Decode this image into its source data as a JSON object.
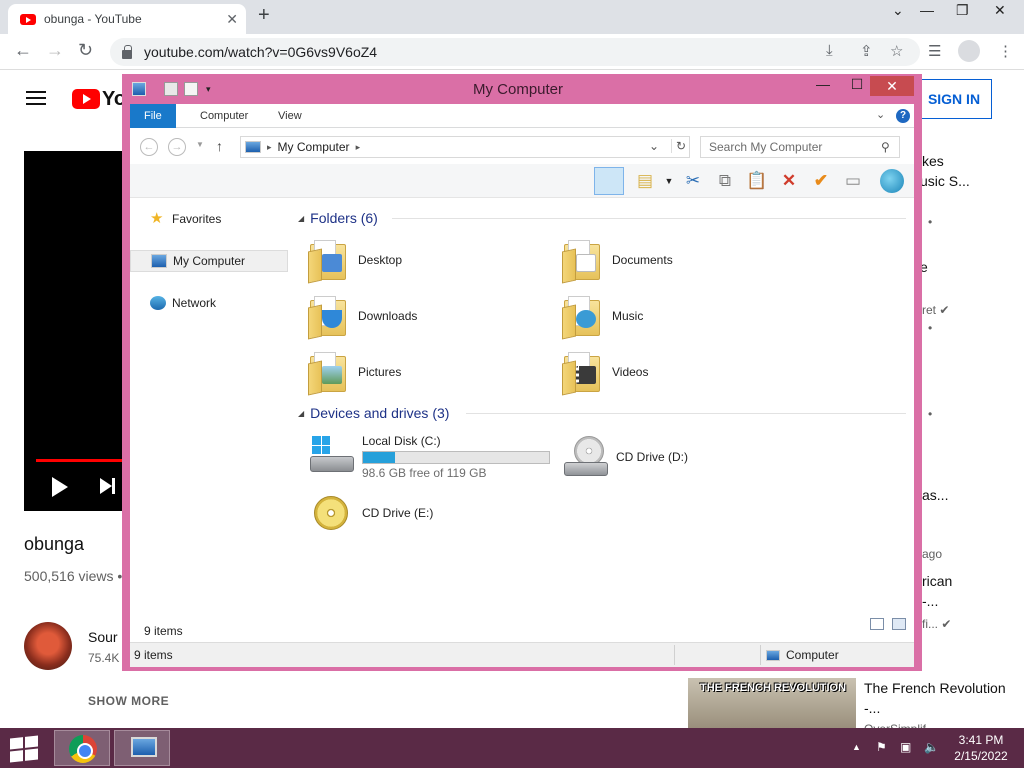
{
  "browser": {
    "tab_title": "obunga - YouTube",
    "tab_close": "✕",
    "new_tab": "+",
    "url": "youtube.com/watch?v=0G6vs9V6oZ4",
    "controls": {
      "collapse": "⌄",
      "minimize": "—",
      "restore": "❐",
      "close": "✕"
    },
    "nav": {
      "back": "←",
      "forward": "→",
      "reload": "↻"
    },
    "toolbar": {
      "download": "⤓",
      "share": "⇪",
      "bookmark": "☆",
      "media": "☰",
      "menu": "⋮"
    }
  },
  "youtube": {
    "logo_text": "Yo",
    "sign_in": "SIGN IN",
    "video_title": "obunga",
    "views": "500,516 views •",
    "channel_name": "Sour",
    "channel_subs": "75.4K",
    "show_more": "SHOW MORE",
    "sidebar_fragments": [
      {
        "text": "kes"
      },
      {
        "text": "usic S..."
      },
      {
        "text": "e"
      },
      {
        "text": "as..."
      },
      {
        "text": "rican"
      },
      {
        "text": "-..."
      }
    ],
    "sidebar_meta": [
      {
        "text": "•"
      },
      {
        "text": "ret ✔"
      },
      {
        "text": "•"
      },
      {
        "text": "•"
      },
      {
        "text": "ago"
      },
      {
        "text": "fi... ✔"
      }
    ],
    "thumb_text": "THE FRENCH REVOLUTION",
    "thumb_title": "The French Revolution -...",
    "thumb_channel": "OverSimplif..."
  },
  "explorer": {
    "title": "My Computer",
    "ribbon_tabs": [
      "File",
      "Computer",
      "View"
    ],
    "help": "?",
    "address": "My Computer",
    "search_placeholder": "Search My Computer",
    "nav_items": [
      {
        "label": "Favorites",
        "icon": "star-icon"
      },
      {
        "label": "My Computer",
        "icon": "computer-icon",
        "selected": true
      },
      {
        "label": "Network",
        "icon": "network-icon"
      }
    ],
    "folders_header": "Folders (6)",
    "folders": [
      {
        "label": "Desktop",
        "badge": "#4b8ad6"
      },
      {
        "label": "Documents",
        "badge": "#ffffff"
      },
      {
        "label": "Downloads",
        "badge": "#2f88d8"
      },
      {
        "label": "Music",
        "badge": "#3a9bd5"
      },
      {
        "label": "Pictures",
        "badge": "#7fb4d8"
      },
      {
        "label": "Videos",
        "badge": "#3a3a3a"
      }
    ],
    "drives_header": "Devices and drives (3)",
    "drives": {
      "c": {
        "name": "Local Disk (C:)",
        "free": "98.6 GB free of 119 GB",
        "used_fraction": 0.171
      },
      "d": {
        "name": "CD Drive (D:)"
      },
      "e": {
        "name": "CD Drive (E:)"
      }
    },
    "items_count": "9 items",
    "status_left": "9 items",
    "status_right": "Computer"
  },
  "taskbar": {
    "time": "3:41 PM",
    "date": "2/15/2022",
    "tray": {
      "up": "▲",
      "flag": "⚑",
      "net": "▣",
      "vol": "🔈"
    }
  }
}
